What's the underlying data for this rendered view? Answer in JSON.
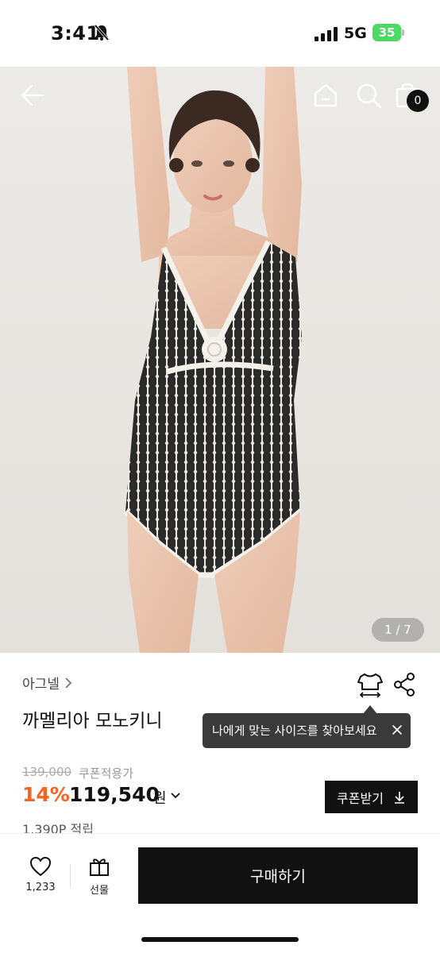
{
  "status_bar": {
    "time": "3:41",
    "network": "5G",
    "battery": "35"
  },
  "gallery": {
    "counter": "1 / 7",
    "cart_count": "0"
  },
  "product": {
    "brand": "아그넬",
    "name": "까멜리아 모노키니",
    "original_price": "139,000",
    "coupon_note": "쿠폰적용가",
    "discount": "14%",
    "price": "119,540",
    "currency": "원",
    "points": "1,390P 적립"
  },
  "tooltip": {
    "text": "나에게 맞는 사이즈를 찾아보세요"
  },
  "coupon_button": {
    "label": "쿠폰받기"
  },
  "bottom": {
    "like_count": "1,233",
    "gift_label": "선물",
    "buy_label": "구매하기"
  },
  "colors": {
    "accent": "#f26522",
    "primary": "#111111",
    "battery": "#4cd964"
  },
  "icons": [
    "back-arrow-icon",
    "home-icon",
    "search-icon",
    "shopping-bag-icon",
    "size-guide-icon",
    "share-icon",
    "heart-icon",
    "gift-icon",
    "download-icon",
    "close-icon",
    "chevron-right-icon",
    "chevron-down-icon"
  ]
}
